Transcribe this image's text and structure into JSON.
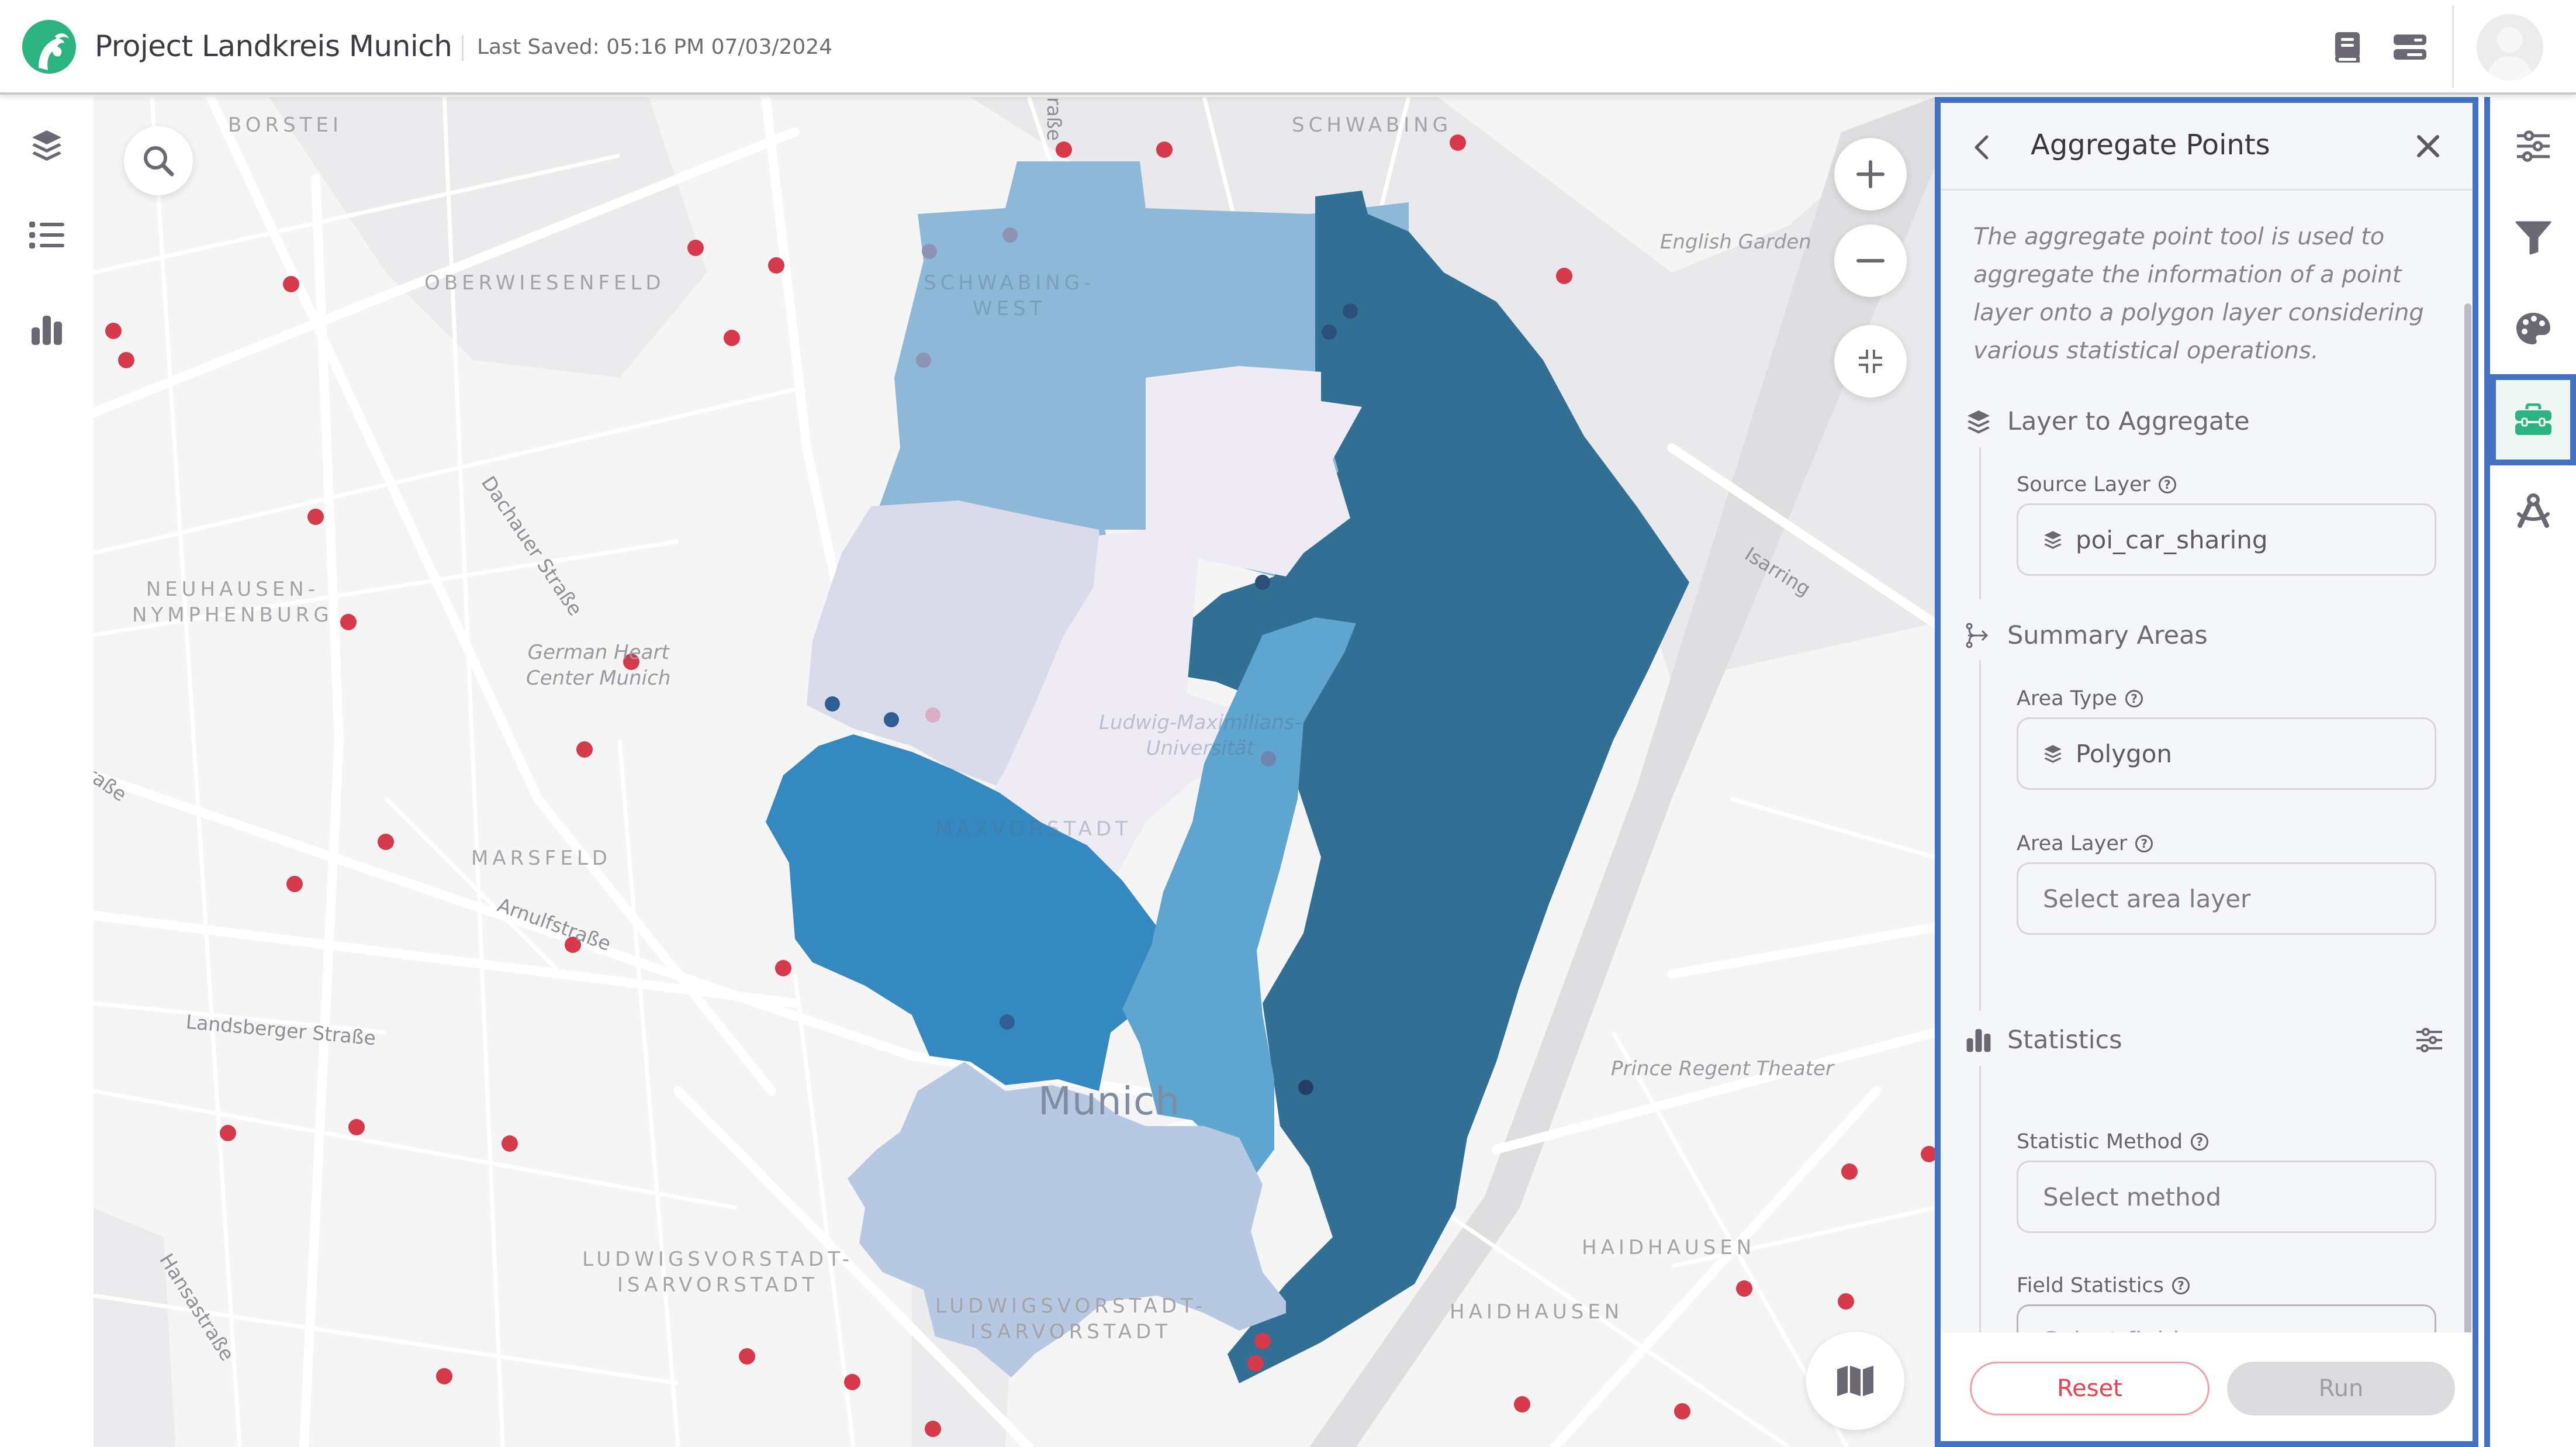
{
  "header": {
    "project_title": "Project Landkreis Munich",
    "last_saved": "Last Saved: 05:16 PM 07/03/2024",
    "icons": [
      "book-icon",
      "toggle-layout-icon"
    ],
    "brand_color": "#2bb381"
  },
  "left_rail": {
    "items": [
      {
        "name": "layers",
        "icon": "layers-icon"
      },
      {
        "name": "legend",
        "icon": "list-icon"
      },
      {
        "name": "charts",
        "icon": "bar-chart-icon"
      }
    ]
  },
  "map": {
    "controls": {
      "search": "search-icon",
      "zoom_in": "plus-icon",
      "zoom_out": "minus-icon",
      "fit": "compress-icon",
      "basemap": "map-icon"
    },
    "labels": {
      "borstei": "BORSTEI",
      "schwabing": "SCHWABING",
      "oberwiesenfeld": "OBERWIESENFELD",
      "schwabing_west": "SCHWABING-\nWEST",
      "english_garden": "English Garden",
      "dachauer": "Dachauer Straße",
      "neuhausen": "NEUHAUSEN-\nNYMPHENBURG",
      "german_heart": "German Heart\nCenter Munich",
      "isarring": "Isarring",
      "lmu": "Ludwig-Maximilians-\nUniversität",
      "maxvorstadt": "MAXVORSTADT",
      "marsfeld": "MARSFELD",
      "arnulf": "Arnulfstraße",
      "landsberger": "Landsberger Straße",
      "munich": "Munich",
      "prince_regent": "Prince Regent Theater",
      "ludwigsvorstadt_1": "LUDWIGSVORSTADT-\nISARVORSTADT",
      "ludwigsvorstadt_2": "LUDWIGSVORSTADT-\nISARVORSTADT",
      "haidhausen_1": "HAIDHAUSEN",
      "haidhausen_2": "HAIDHAUSEN",
      "hansa": "Hansastraße",
      "strasse_top": "raße",
      "strasse_left": "raße"
    },
    "point_color": "#d63a4a",
    "choropleth_colors": [
      "#eeebf5",
      "#d9dbea",
      "#b7c9e2",
      "#8db8d8",
      "#5ea5cf",
      "#3489c0",
      "#326f95"
    ]
  },
  "panel": {
    "title": "Aggregate Points",
    "description": "The aggregate point tool is used to aggregate the information of a point layer onto a polygon layer considering various statistical operations.",
    "sections": {
      "layer": {
        "title": "Layer to Aggregate",
        "source_label": "Source Layer",
        "source_value": "poi_car_sharing"
      },
      "areas": {
        "title": "Summary Areas",
        "area_type_label": "Area Type",
        "area_type_value": "Polygon",
        "area_layer_label": "Area Layer",
        "area_layer_placeholder": "Select area layer"
      },
      "stats": {
        "title": "Statistics",
        "method_label": "Statistic Method",
        "method_placeholder": "Select method",
        "field_label": "Field Statistics",
        "field_placeholder": "Select field"
      }
    },
    "help_glyph": "?",
    "buttons": {
      "reset": "Reset",
      "run": "Run"
    }
  },
  "right_rail": {
    "items": [
      {
        "name": "properties",
        "icon": "sliders-icon",
        "active": false
      },
      {
        "name": "filter",
        "icon": "filter-icon",
        "active": false
      },
      {
        "name": "style",
        "icon": "palette-icon",
        "active": false
      },
      {
        "name": "toolbox",
        "icon": "toolbox-icon",
        "active": true
      },
      {
        "name": "scenario",
        "icon": "compass-drafting-icon",
        "active": false
      }
    ],
    "active_color": "#2bb381"
  }
}
